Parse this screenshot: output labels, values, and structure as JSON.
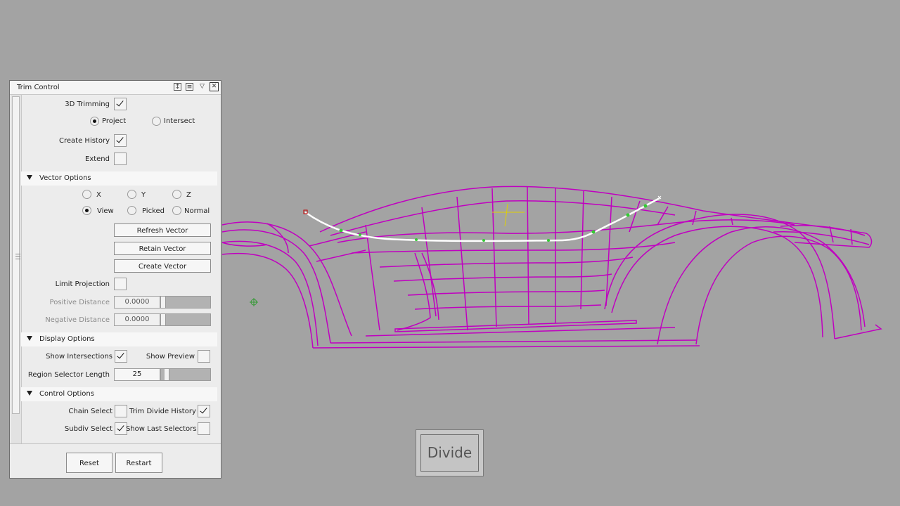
{
  "panel": {
    "title": "Trim Control",
    "trimming_3d": {
      "label": "3D Trimming",
      "checked": true
    },
    "mode": {
      "project": "Project",
      "intersect": "Intersect",
      "selected": "Project"
    },
    "create_history": {
      "label": "Create History",
      "checked": true
    },
    "extend": {
      "label": "Extend",
      "checked": false
    },
    "vector_options": {
      "title": "Vector Options",
      "radios": [
        "X",
        "Y",
        "Z",
        "View",
        "Picked",
        "Normal"
      ],
      "selected": "View",
      "refresh": "Refresh Vector",
      "retain": "Retain Vector",
      "create": "Create Vector",
      "limit_projection": {
        "label": "Limit Projection",
        "checked": false
      },
      "positive_distance": {
        "label": "Positive Distance",
        "value": "0.0000"
      },
      "negative_distance": {
        "label": "Negative Distance",
        "value": "0.0000"
      }
    },
    "display_options": {
      "title": "Display Options",
      "show_intersections": {
        "label": "Show Intersections",
        "checked": true
      },
      "show_preview": {
        "label": "Show Preview",
        "checked": false
      },
      "region_selector_length": {
        "label": "Region Selector Length",
        "value": "25"
      }
    },
    "control_options": {
      "title": "Control Options",
      "chain_select": {
        "label": "Chain Select",
        "checked": false
      },
      "trim_divide_history": {
        "label": "Trim Divide History",
        "checked": true
      },
      "subdiv_select": {
        "label": "Subdiv Select",
        "checked": true
      },
      "show_last_selectors": {
        "label": "Show Last Selectors",
        "checked": false
      }
    },
    "reset": "Reset",
    "restart": "Restart"
  },
  "viewport": {
    "divide_button": "Divide",
    "wireframe_color": "#c000c0",
    "curve_color": "#ffffff",
    "point_color": "#33cc33"
  }
}
